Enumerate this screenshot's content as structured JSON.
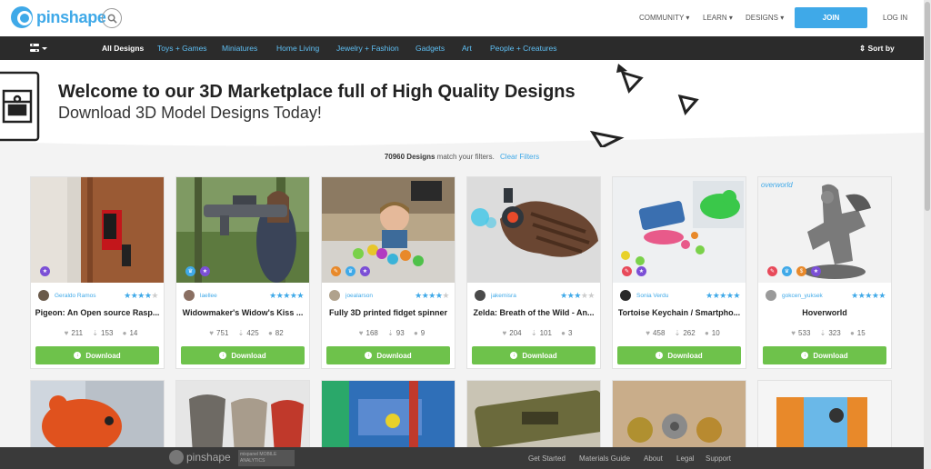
{
  "header": {
    "logo_text": "pinshape",
    "nav": [
      "COMMUNITY ▾",
      "LEARN ▾",
      "DESIGNS ▾"
    ],
    "join_label": "JOIN",
    "login_label": "LOG IN"
  },
  "categories": {
    "items": [
      "All Designs",
      "Toys + Games",
      "Miniatures",
      "Home Living",
      "Jewelry + Fashion",
      "Gadgets",
      "Art",
      "People + Creatures"
    ],
    "active": "All Designs",
    "sort_label": "⇕ Sort by"
  },
  "hero": {
    "title": "Welcome to our 3D Marketplace full of High Quality Designs",
    "subtitle": "Download 3D Model Designs Today!"
  },
  "results": {
    "count": "70960 Designs",
    "text": "match your filters.",
    "clear_label": "Clear Filters"
  },
  "cards": [
    {
      "user": "Geraldo Ramos",
      "title": "Pigeon: An Open source Rasp...",
      "likes": "211",
      "downloads": "153",
      "comments": "14",
      "rating": 4,
      "download_label": "Download"
    },
    {
      "user": "laellee",
      "title": "Widowmaker's Widow's Kiss ...",
      "likes": "751",
      "downloads": "425",
      "comments": "82",
      "rating": 5,
      "download_label": "Download"
    },
    {
      "user": "joealarson",
      "title": "Fully 3D printed fidget spinner",
      "likes": "168",
      "downloads": "93",
      "comments": "9",
      "rating": 4,
      "download_label": "Download"
    },
    {
      "user": "jakemisra",
      "title": "Zelda: Breath of the Wild - An...",
      "likes": "204",
      "downloads": "101",
      "comments": "3",
      "rating": 3,
      "download_label": "Download"
    },
    {
      "user": "Sonia Verdu",
      "title": "Tortoise Keychain / Smartpho...",
      "likes": "458",
      "downloads": "262",
      "comments": "10",
      "rating": 5,
      "download_label": "Download"
    },
    {
      "user": "gokcen_yuksek",
      "title": "Hoverworld",
      "likes": "533",
      "downloads": "323",
      "comments": "15",
      "rating": 5,
      "download_label": "Download"
    }
  ],
  "card_overlay_texts": {
    "hoverworld_tag": "overworld"
  },
  "footer": {
    "logo_text": "pinshape",
    "badge_line1": "mixpanel MOBILE",
    "badge_line2": "ANALYTICS",
    "links": [
      "Get Started",
      "Materials Guide",
      "About",
      "Legal",
      "Support"
    ]
  },
  "colors": {
    "accent": "#3fa9e8",
    "download": "#6ec24b",
    "navbar": "#2b2b2b",
    "footer": "#3a3a3a"
  }
}
